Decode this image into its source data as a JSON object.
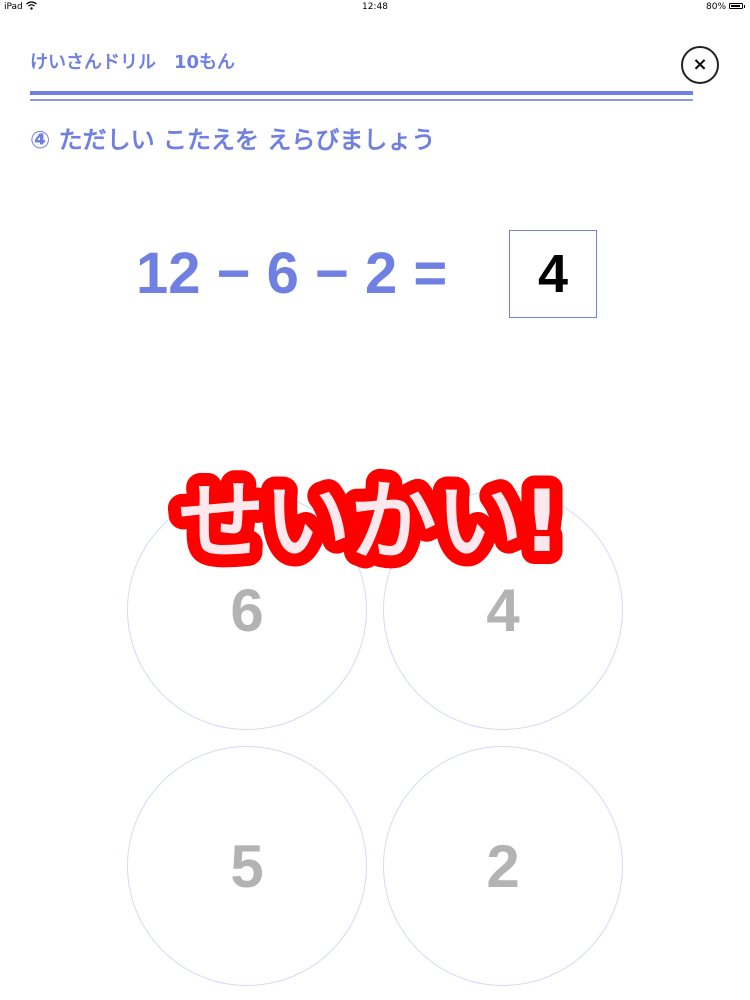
{
  "status_bar": {
    "device": "iPad",
    "time": "12:48",
    "battery": "80%"
  },
  "header": {
    "title": "けいさんドリル　10もん",
    "close_label": "×"
  },
  "question": {
    "instruction": "④ ただしい こたえを えらびましょう",
    "equation": "12 − 6 − 2 =",
    "answer": "4"
  },
  "choices": [
    "6",
    "4",
    "5",
    "2"
  ],
  "feedback": {
    "text": "せいかい!"
  },
  "colors": {
    "accent": "#6f80e2",
    "feedback_red": "#ff0000",
    "feedback_fill": "#fde8ee",
    "choice_text": "#b3b3b3"
  }
}
